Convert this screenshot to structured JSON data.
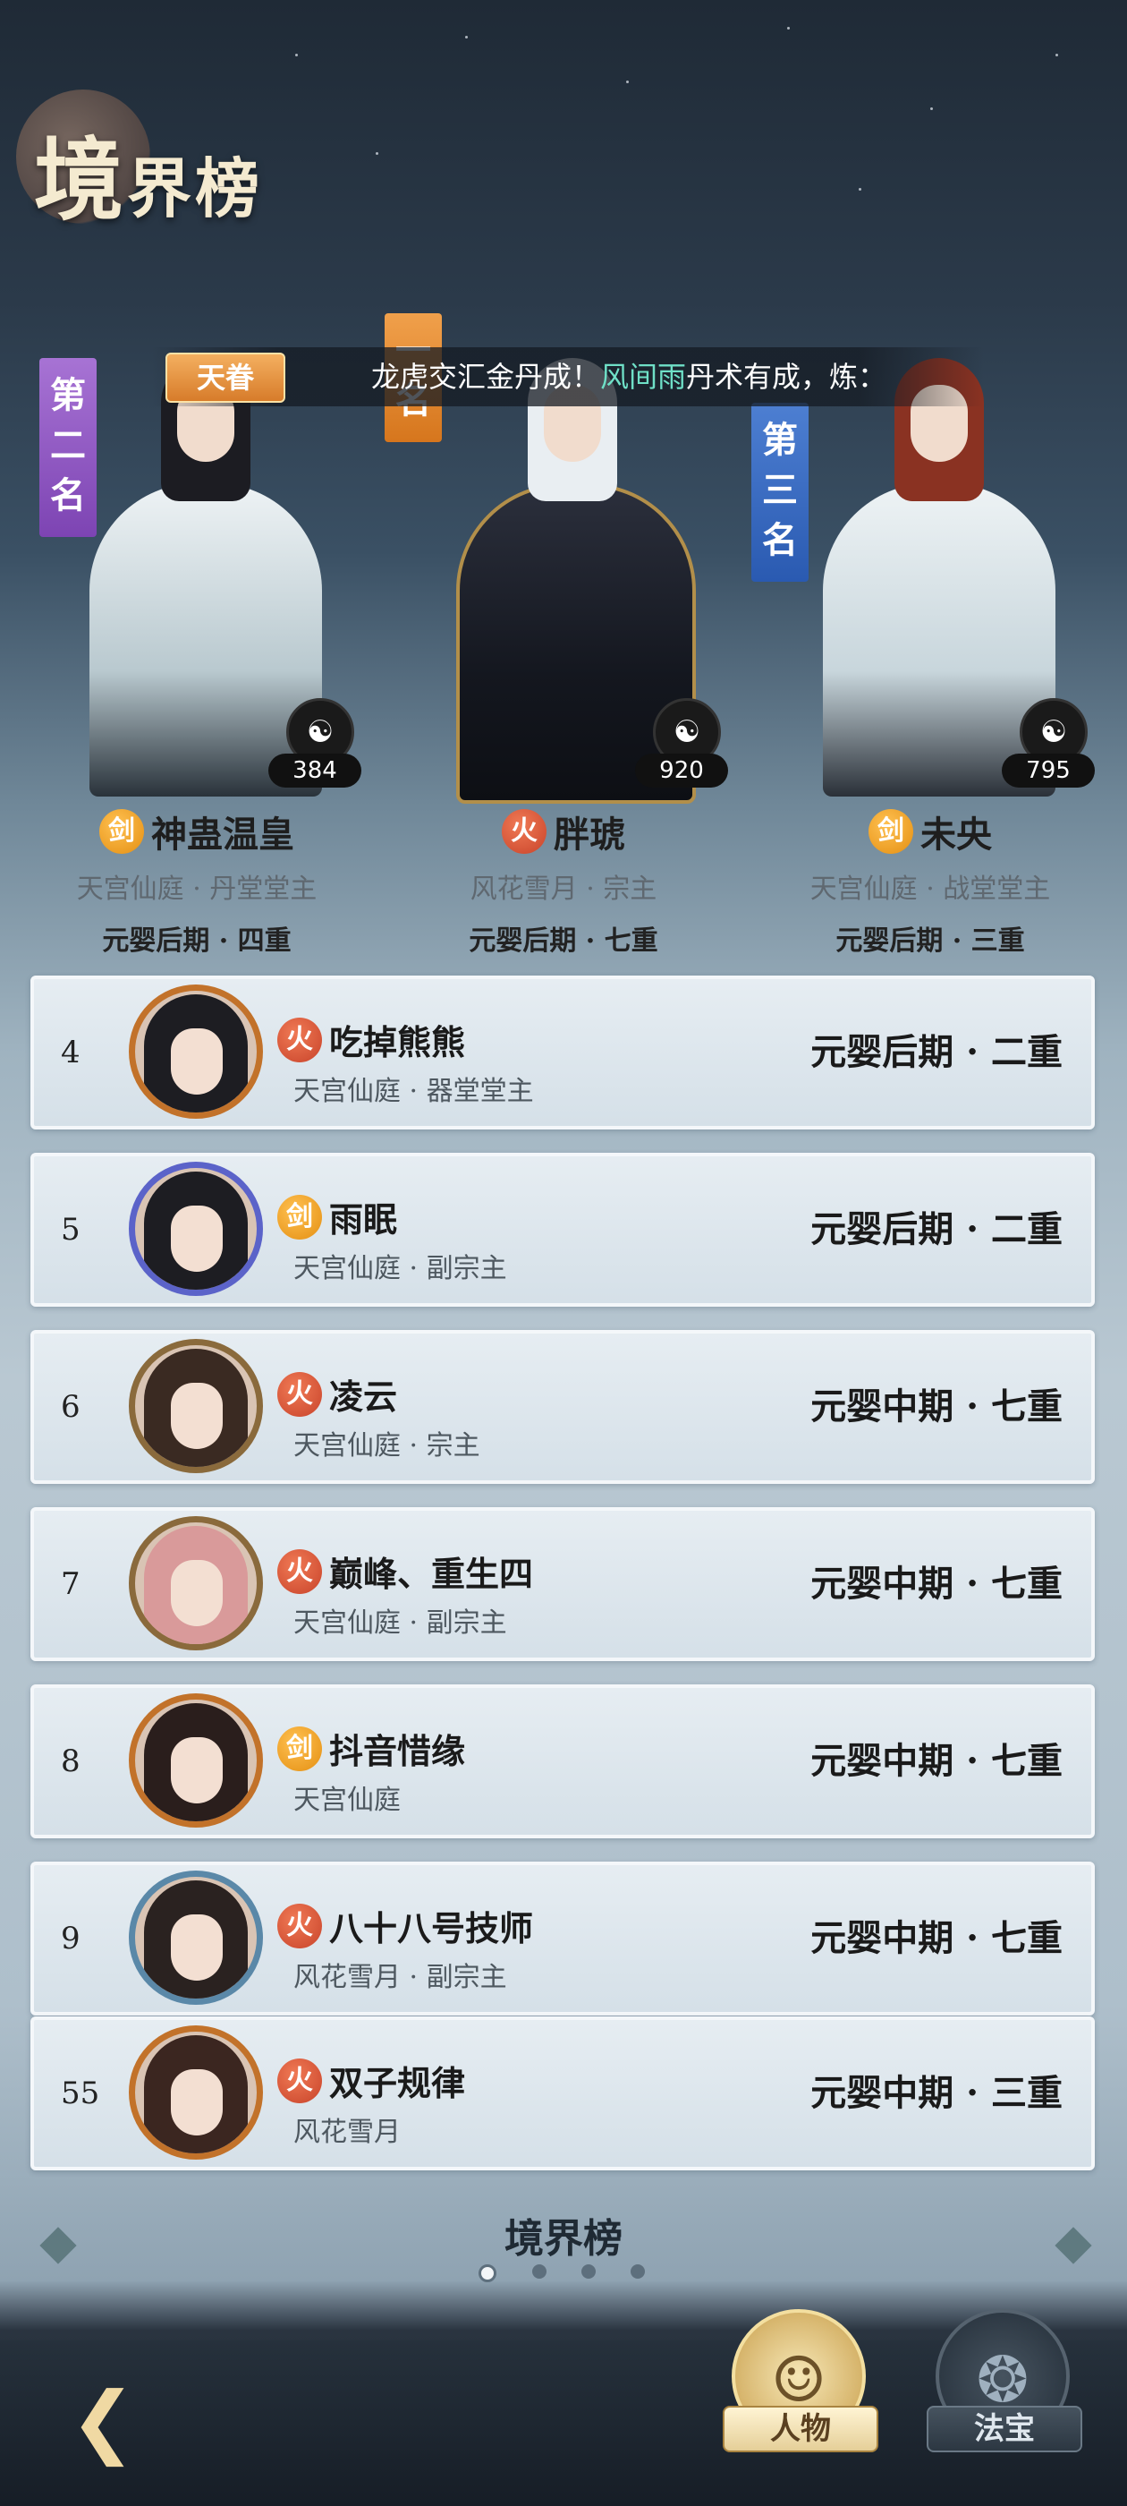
{
  "header": {
    "title_big": "境",
    "title_rest": "界榜"
  },
  "broadcast": {
    "badge": "天眷",
    "text_a": "龙虎交汇金丹成！",
    "text_highlight": "风间雨",
    "text_b": "丹术有成，炼："
  },
  "top3": [
    {
      "rank_label": "第二名",
      "score": "384",
      "element": "剑",
      "element_type": "sword",
      "name": "神蛊温皇",
      "sect": "天宫仙庭 · 丹堂堂主",
      "realm": "元婴后期 · 四重"
    },
    {
      "rank_label": "一名",
      "score": "920",
      "element": "火",
      "element_type": "fire",
      "name": "胖琥",
      "sect": "风花雪月 · 宗主",
      "realm": "元婴后期 · 七重"
    },
    {
      "rank_label": "第三名",
      "score": "795",
      "element": "剑",
      "element_type": "sword",
      "name": "未央",
      "sect": "天宫仙庭 · 战堂堂主",
      "realm": "元婴后期 · 三重"
    }
  ],
  "rows": [
    {
      "rank": "4",
      "element": "火",
      "name": "吃掉熊熊",
      "sect": "天宫仙庭 · 器堂堂主",
      "realm": "元婴后期 · 二重"
    },
    {
      "rank": "5",
      "element": "剑",
      "name": "雨眠",
      "sect": "天宫仙庭 · 副宗主",
      "realm": "元婴后期 · 二重"
    },
    {
      "rank": "6",
      "element": "火",
      "name": "凌云",
      "sect": "天宫仙庭 · 宗主",
      "realm": "元婴中期 · 七重"
    },
    {
      "rank": "7",
      "element": "火",
      "name": "巅峰、重生四",
      "sect": "天宫仙庭 · 副宗主",
      "realm": "元婴中期 · 七重"
    },
    {
      "rank": "8",
      "element": "剑",
      "name": "抖音惜缘",
      "sect": "天宫仙庭",
      "realm": "元婴中期 · 七重"
    },
    {
      "rank": "9",
      "element": "火",
      "name": "八十八号技师",
      "sect": "风花雪月 · 副宗主",
      "realm": "元婴中期 · 七重"
    },
    {
      "rank": "55",
      "element": "火",
      "name": "双子规律",
      "sect": "风花雪月",
      "realm": "元婴中期 · 三重"
    }
  ],
  "pager": {
    "title": "境界榜",
    "pages": 4,
    "current": 1
  },
  "tabs": {
    "characters": "人物",
    "treasures": "法宝"
  },
  "colors": {
    "fire": "#d2512f",
    "sword": "#ee9c1a",
    "gold": "#f0d9a3"
  }
}
